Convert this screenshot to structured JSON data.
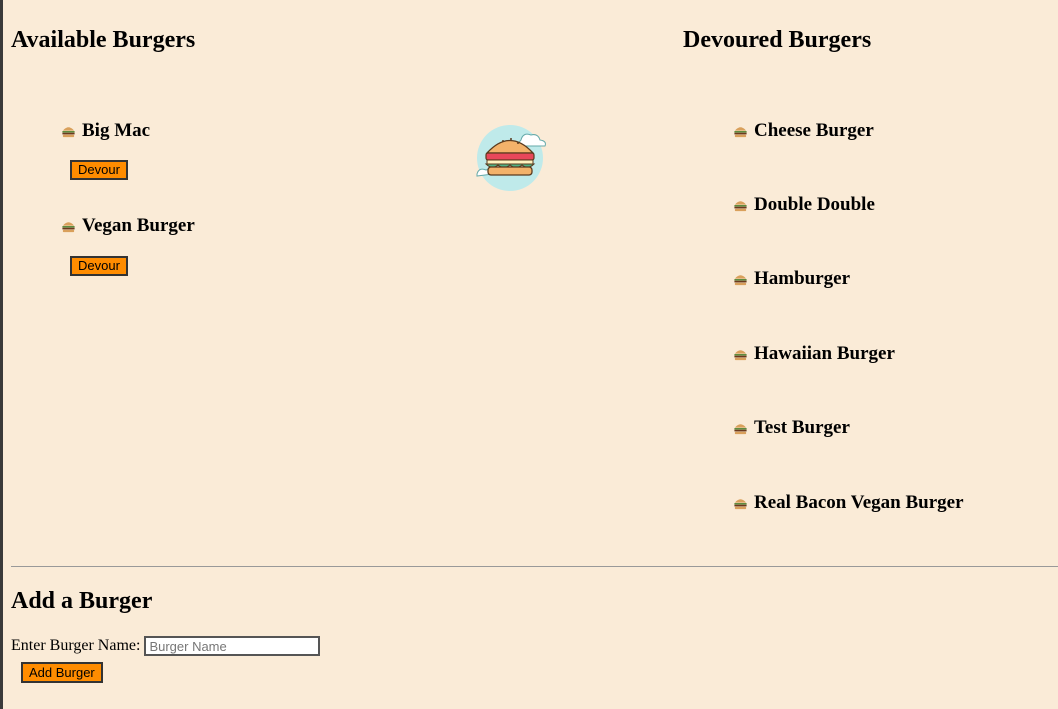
{
  "headings": {
    "available": "Available Burgers",
    "devoured": "Devoured Burgers",
    "add": "Add a Burger"
  },
  "available_burgers": [
    {
      "name": "Big Mac",
      "button_label": "Devour"
    },
    {
      "name": "Vegan Burger",
      "button_label": "Devour"
    }
  ],
  "devoured_burgers": [
    {
      "name": "Cheese Burger"
    },
    {
      "name": "Double Double"
    },
    {
      "name": "Hamburger"
    },
    {
      "name": "Hawaiian Burger"
    },
    {
      "name": "Test Burger"
    },
    {
      "name": "Real Bacon Vegan Burger"
    }
  ],
  "form": {
    "label": "Enter Burger Name:",
    "placeholder": "Burger Name",
    "value": "",
    "submit_label": "Add Burger"
  },
  "icons": {
    "list_icon": "burger-emoji-icon",
    "logo": "burger-logo-icon"
  },
  "colors": {
    "background": "#faebd7",
    "button": "#ff8c00"
  }
}
